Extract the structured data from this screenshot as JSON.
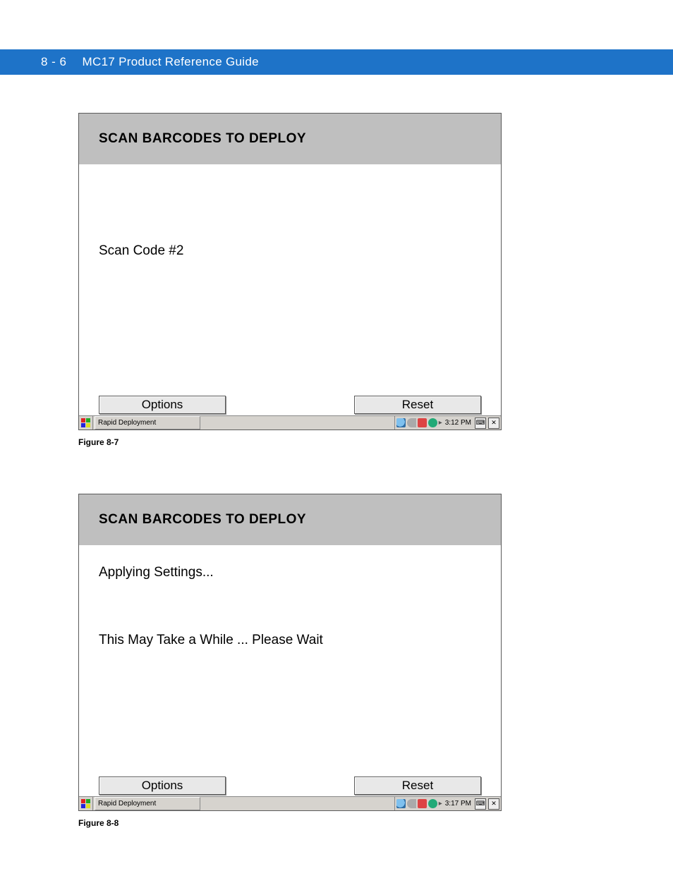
{
  "header": {
    "page_num": "8 - 6",
    "title": "MC17 Product Reference Guide"
  },
  "figure1": {
    "caption": "Figure 8-7",
    "window": {
      "title": "SCAN BARCODES TO DEPLOY",
      "body_line1": "Scan Code #2",
      "options_label": "Options",
      "reset_label": "Reset",
      "task_label": "Rapid Deployment",
      "time": "3:12 PM",
      "sip_label": "⌨",
      "close_label": "✕"
    }
  },
  "figure2": {
    "caption": "Figure 8-8",
    "window": {
      "title": "SCAN BARCODES TO DEPLOY",
      "body_line1": "Applying Settings...",
      "body_line2": "This May Take a While ... Please Wait",
      "options_label": "Options",
      "reset_label": "Reset",
      "task_label": "Rapid Deployment",
      "time": "3:17 PM",
      "sip_label": "⌨",
      "close_label": "✕"
    }
  }
}
